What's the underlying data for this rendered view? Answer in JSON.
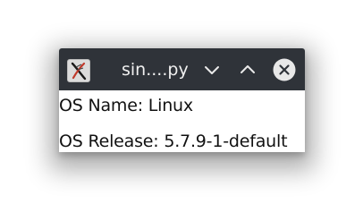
{
  "window": {
    "title": "sin....py",
    "titlebar_color": "#2f3339",
    "app_icon": "tk-feather-icon"
  },
  "controls": {
    "minimize_icon": "chevron-down-icon",
    "maximize_icon": "chevron-up-icon",
    "close_icon": "close-circle-icon"
  },
  "content": {
    "os_name": "OS Name: Linux",
    "os_release": "OS Release: 5.7.9-1-default"
  }
}
